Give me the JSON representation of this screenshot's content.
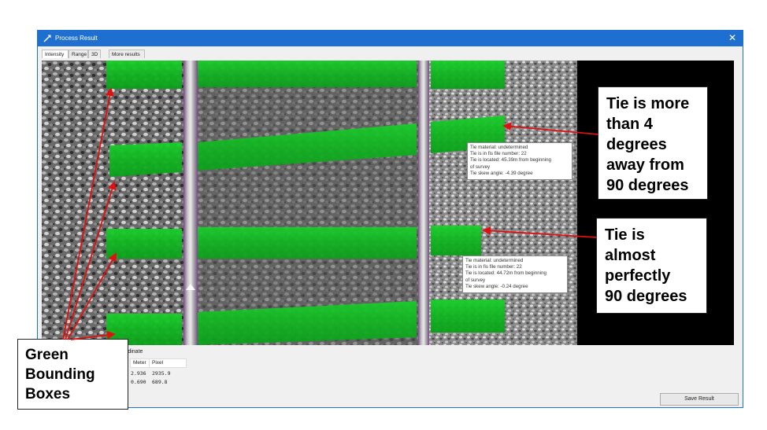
{
  "window": {
    "title": "Process Result",
    "close_glyph": "✕"
  },
  "tabs": [
    {
      "label": "Intensity",
      "active": true
    },
    {
      "label": "Range",
      "active": false
    },
    {
      "label": "3D",
      "active": false
    },
    {
      "label": "More results",
      "active": false
    }
  ],
  "tooltips": [
    {
      "lines": [
        "Tie material: undetermined",
        "Tie is in fis file number: 22",
        "Tie is located: 45.39m from beginning",
        "of survey",
        "Tie skew angle: -4.39 degree"
      ]
    },
    {
      "lines": [
        "Tie material: undetermined",
        "Tie is in fis file number: 22",
        "Tie is located: 44.72m from beginning",
        "of survey",
        "Tie skew angle: -0.24 degree"
      ]
    }
  ],
  "coordinate": {
    "title": "rdinate",
    "headers": [
      "Meter",
      "Pixel"
    ],
    "rows": [
      [
        "2.936",
        "2935.9"
      ],
      [
        "0.690",
        "689.8"
      ]
    ]
  },
  "save_button": {
    "label": "Save Result"
  },
  "callouts": {
    "skew": [
      "Tie is more",
      "than 4",
      "degrees",
      "away from",
      "90 degrees"
    ],
    "straight": [
      "Tie is",
      "almost",
      "perfectly",
      "90 degrees"
    ],
    "boxes": [
      "Green",
      "Bounding",
      "Boxes"
    ]
  },
  "colors": {
    "window_titlebar": "#1f6fd0",
    "bounding_box_green": "#12c424",
    "annotation_arrow": "#e01010",
    "rail_purple": "#8a5a9a"
  },
  "icons": {
    "title": "app-logo-icon",
    "close": "close-icon"
  }
}
